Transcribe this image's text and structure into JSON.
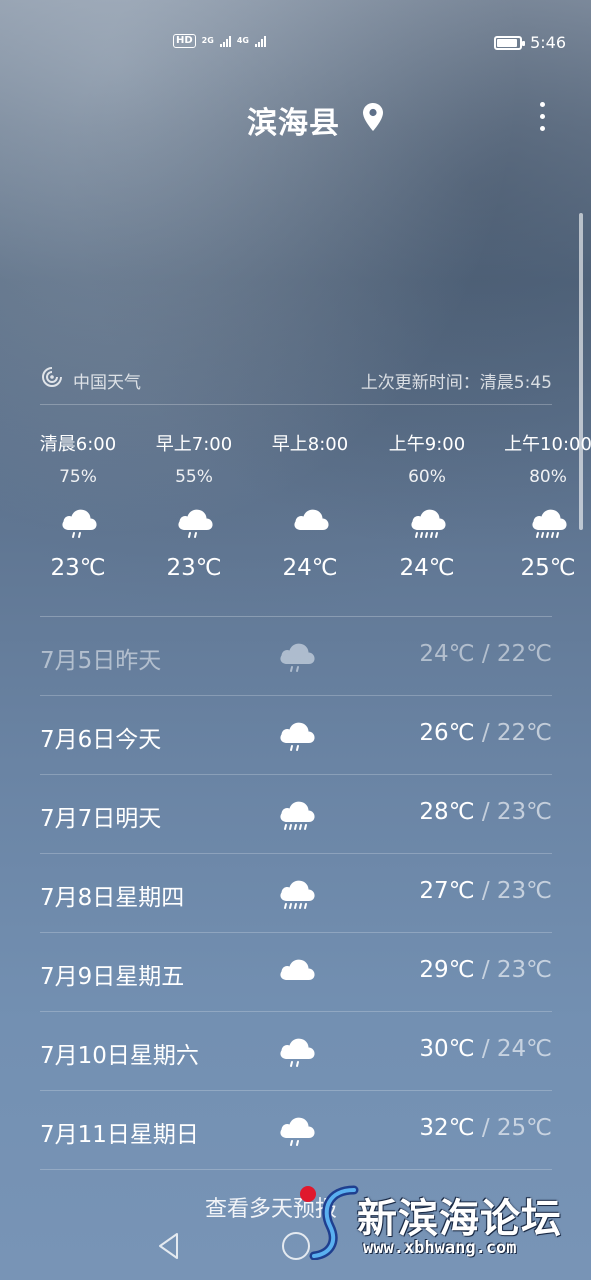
{
  "status_bar": {
    "hd_label": "HD",
    "net1": "2G",
    "net2": "4G",
    "battery_level": 0.9,
    "time": "5:46"
  },
  "header": {
    "city": "滨海县",
    "location_icon": "location-pin-icon",
    "menu_icon": "more-vertical-icon"
  },
  "source": {
    "icon": "china-weather-logo-icon",
    "name": "中国天气",
    "updated": "上次更新时间：清晨5:45"
  },
  "hourly": [
    {
      "time": "清晨6:00",
      "prob": "75%",
      "icon": "light-rain-icon",
      "temp": "23℃"
    },
    {
      "time": "早上7:00",
      "prob": "55%",
      "icon": "light-rain-icon",
      "temp": "23℃"
    },
    {
      "time": "早上8:00",
      "prob": "",
      "icon": "cloudy-icon",
      "temp": "24℃"
    },
    {
      "time": "上午9:00",
      "prob": "60%",
      "icon": "moderate-rain-icon",
      "temp": "24℃"
    },
    {
      "time": "上午10:00",
      "prob": "80%",
      "icon": "moderate-rain-icon",
      "temp": "25℃"
    }
  ],
  "daily": [
    {
      "date": "7月5日昨天",
      "icon": "light-rain-icon",
      "high": "24℃",
      "low": " / 22℃",
      "past": true
    },
    {
      "date": "7月6日今天",
      "icon": "light-rain-icon",
      "high": "26℃",
      "low": " / 22℃",
      "past": false
    },
    {
      "date": "7月7日明天",
      "icon": "moderate-rain-icon",
      "high": "28℃",
      "low": " / 23℃",
      "past": false
    },
    {
      "date": "7月8日星期四",
      "icon": "moderate-rain-icon",
      "high": "27℃",
      "low": " / 23℃",
      "past": false
    },
    {
      "date": "7月9日星期五",
      "icon": "cloudy-icon",
      "high": "29℃",
      "low": " / 23℃",
      "past": false
    },
    {
      "date": "7月10日星期六",
      "icon": "light-rain-icon",
      "high": "30℃",
      "low": " / 24℃",
      "past": false
    },
    {
      "date": "7月11日星期日",
      "icon": "light-rain-icon",
      "high": "32℃",
      "low": " / 25℃",
      "past": false
    }
  ],
  "more_link": "查看多天预报",
  "nav": {
    "back_icon": "nav-back-icon",
    "home_icon": "nav-home-icon"
  },
  "watermark": {
    "title": "新滨海论坛",
    "url": "www.xbhwang.com"
  }
}
